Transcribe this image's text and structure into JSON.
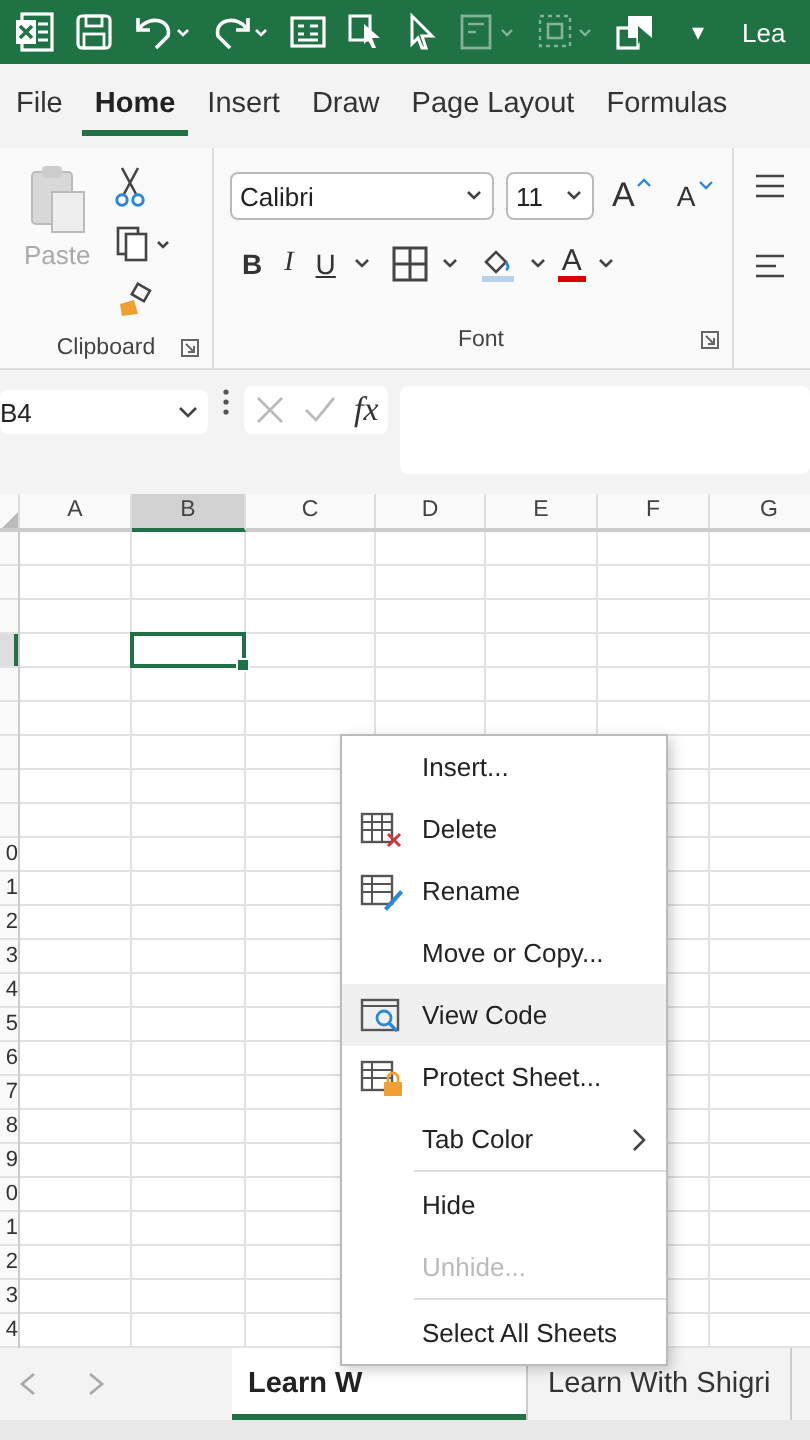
{
  "title_bar": {
    "title": "Lea",
    "menu_glyph": "▾"
  },
  "tabs": [
    {
      "label": "File",
      "selected": false
    },
    {
      "label": "Home",
      "selected": true
    },
    {
      "label": "Insert",
      "selected": false
    },
    {
      "label": "Draw",
      "selected": false
    },
    {
      "label": "Page Layout",
      "selected": false
    },
    {
      "label": "Formulas",
      "selected": false
    }
  ],
  "clipboard": {
    "paste_label": "Paste",
    "paste_disabled": true,
    "group_label": "Clipboard"
  },
  "font": {
    "family": "Calibri",
    "size": "11",
    "grow": "A",
    "shrink": "A",
    "bold": "B",
    "italic": "I",
    "underline": "U",
    "font_color": "A",
    "group_label": "Font"
  },
  "formula_bar": {
    "name_box": "B4",
    "fx": "fx"
  },
  "columns": [
    {
      "label": "A",
      "selected": false
    },
    {
      "label": "B",
      "selected": true
    },
    {
      "label": "C",
      "selected": false
    },
    {
      "label": "D",
      "selected": false
    },
    {
      "label": "E",
      "selected": false
    },
    {
      "label": "F",
      "selected": false
    },
    {
      "label": "G",
      "selected": false
    }
  ],
  "row_labels": [
    "0",
    "1",
    "2",
    "3",
    "4",
    "5",
    "6",
    "7",
    "8",
    "9",
    "0",
    "1",
    "2",
    "3",
    "4"
  ],
  "context_menu": [
    {
      "label": "Insert...",
      "highlighted": false,
      "disabled": false,
      "submenu": false,
      "separator_before": false
    },
    {
      "label": "Delete",
      "highlighted": false,
      "disabled": false,
      "submenu": false,
      "separator_before": false
    },
    {
      "label": "Rename",
      "highlighted": false,
      "disabled": false,
      "submenu": false,
      "separator_before": false
    },
    {
      "label": "Move or Copy...",
      "highlighted": false,
      "disabled": false,
      "submenu": false,
      "separator_before": false
    },
    {
      "label": "View Code",
      "highlighted": true,
      "disabled": false,
      "submenu": false,
      "separator_before": false
    },
    {
      "label": "Protect Sheet...",
      "highlighted": false,
      "disabled": false,
      "submenu": false,
      "separator_before": false
    },
    {
      "label": "Tab Color",
      "highlighted": false,
      "disabled": false,
      "submenu": true,
      "separator_before": false
    },
    {
      "label": "Hide",
      "highlighted": false,
      "disabled": false,
      "submenu": false,
      "separator_before": true
    },
    {
      "label": "Unhide...",
      "highlighted": false,
      "disabled": true,
      "submenu": false,
      "separator_before": false
    },
    {
      "label": "Select All Sheets",
      "highlighted": false,
      "disabled": false,
      "submenu": false,
      "separator_before": true
    }
  ],
  "sheet_tabs": [
    {
      "label": "Learn W",
      "selected": true
    },
    {
      "label": "Learn With Shigri",
      "selected": false
    }
  ]
}
